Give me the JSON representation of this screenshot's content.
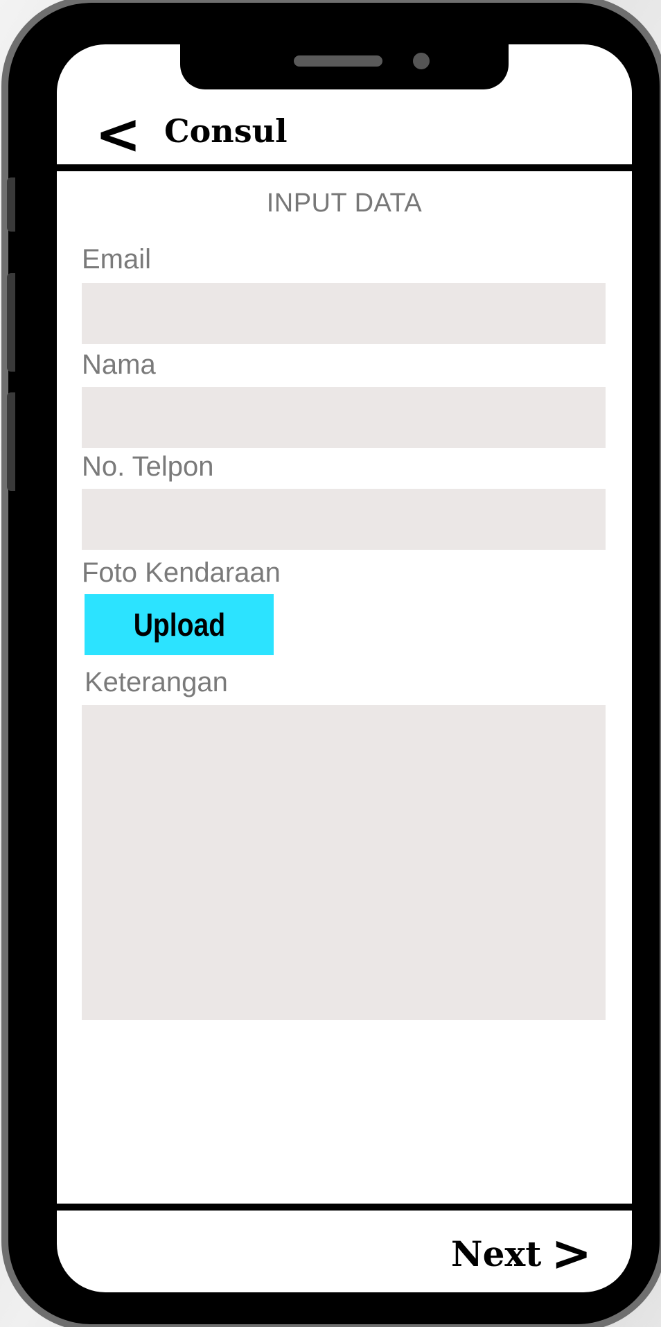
{
  "header": {
    "back_icon": "<",
    "title": "Consul"
  },
  "form": {
    "section_title": "INPUT DATA",
    "email_label": "Email",
    "email_value": "",
    "nama_label": "Nama",
    "nama_value": "",
    "telpon_label": "No. Telpon",
    "telpon_value": "",
    "foto_label": "Foto Kendaraan",
    "upload_label": "Upload",
    "keterangan_label": "Keterangan",
    "keterangan_value": ""
  },
  "footer": {
    "next_label": "Next",
    "next_icon": ">"
  },
  "colors": {
    "upload_button": "#2ce3ff",
    "field_background": "#ebe7e6",
    "label_text": "#7a7a7a"
  },
  "icons": {
    "back": "chevron-left-icon",
    "next": "chevron-right-icon"
  }
}
